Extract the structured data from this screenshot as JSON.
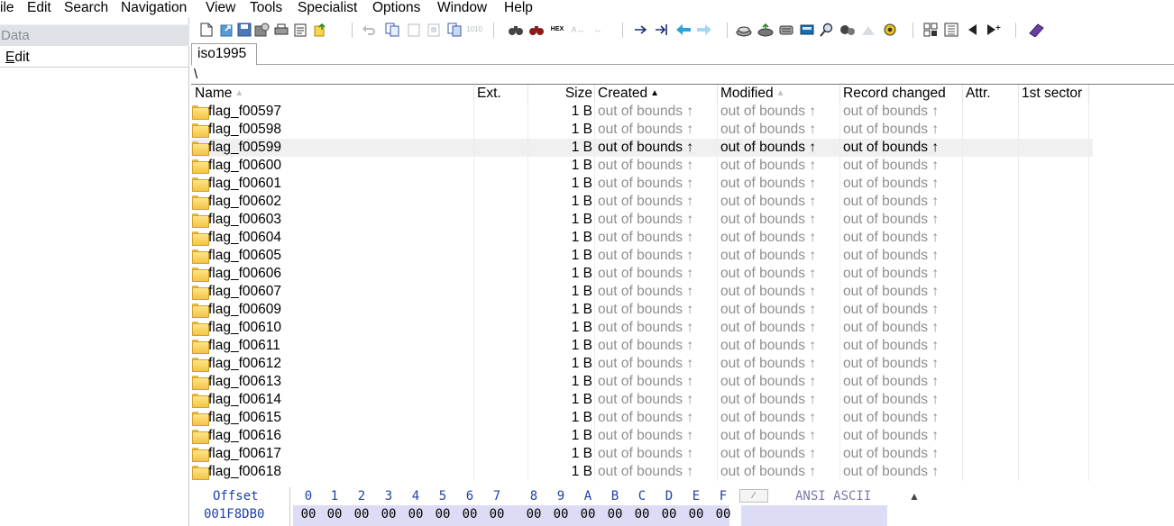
{
  "menu": [
    "ile",
    "Edit",
    "Search",
    "Navigation",
    "View",
    "Tools",
    "Specialist",
    "Options",
    "Window",
    "Help"
  ],
  "left_panel": {
    "header": "Data",
    "edit_prefix": "E",
    "edit_rest": "dit"
  },
  "toolbar": {
    "icons": [
      "new-file-icon",
      "open-file-icon",
      "save-icon",
      "save-as-icon",
      "print-icon",
      "properties-icon",
      "exit-icon",
      "undo-icon",
      "copy-icon",
      "paste-icon",
      "paste-write-icon",
      "copy-hex-icon",
      "find-icon",
      "find-text-icon",
      "find-hex-icon",
      "replace-text-icon",
      "replace-hex-icon",
      "goto-offset-icon",
      "goto-sector-icon",
      "back-icon",
      "forward-icon",
      "open-disk-icon",
      "open-ram-icon",
      "disk-clone-icon",
      "calculator-icon",
      "zoom-icon",
      "tools-icon",
      "hash-icon",
      "gear-icon",
      "directory-browser-icon",
      "sector-view-icon",
      "previous-icon",
      "next-icon",
      "manual-icon"
    ]
  },
  "tab": {
    "label": "iso1995"
  },
  "path": "\\",
  "columns": {
    "name": "Name",
    "ext": "Ext.",
    "size": "Size",
    "created": "Created",
    "modified": "Modified",
    "record_changed": "Record changed",
    "attr": "Attr.",
    "first_sector": "1st sector"
  },
  "sorted_column": "Created",
  "rows": [
    {
      "name": "flag_f00597",
      "size": "1 B",
      "created": "out of bounds ↑",
      "modified": "out of bounds ↑",
      "record_changed": "out of bounds ↑"
    },
    {
      "name": "flag_f00598",
      "size": "1 B",
      "created": "out of bounds ↑",
      "modified": "out of bounds ↑",
      "record_changed": "out of bounds ↑"
    },
    {
      "name": "flag_f00599",
      "size": "1 B",
      "created": "out of bounds ↑",
      "modified": "out of bounds ↑",
      "record_changed": "out of bounds ↑",
      "selected": true
    },
    {
      "name": "flag_f00600",
      "size": "1 B",
      "created": "out of bounds ↑",
      "modified": "out of bounds ↑",
      "record_changed": "out of bounds ↑"
    },
    {
      "name": "flag_f00601",
      "size": "1 B",
      "created": "out of bounds ↑",
      "modified": "out of bounds ↑",
      "record_changed": "out of bounds ↑"
    },
    {
      "name": "flag_f00602",
      "size": "1 B",
      "created": "out of bounds ↑",
      "modified": "out of bounds ↑",
      "record_changed": "out of bounds ↑"
    },
    {
      "name": "flag_f00603",
      "size": "1 B",
      "created": "out of bounds ↑",
      "modified": "out of bounds ↑",
      "record_changed": "out of bounds ↑"
    },
    {
      "name": "flag_f00604",
      "size": "1 B",
      "created": "out of bounds ↑",
      "modified": "out of bounds ↑",
      "record_changed": "out of bounds ↑"
    },
    {
      "name": "flag_f00605",
      "size": "1 B",
      "created": "out of bounds ↑",
      "modified": "out of bounds ↑",
      "record_changed": "out of bounds ↑"
    },
    {
      "name": "flag_f00606",
      "size": "1 B",
      "created": "out of bounds ↑",
      "modified": "out of bounds ↑",
      "record_changed": "out of bounds ↑"
    },
    {
      "name": "flag_f00607",
      "size": "1 B",
      "created": "out of bounds ↑",
      "modified": "out of bounds ↑",
      "record_changed": "out of bounds ↑"
    },
    {
      "name": "flag_f00609",
      "size": "1 B",
      "created": "out of bounds ↑",
      "modified": "out of bounds ↑",
      "record_changed": "out of bounds ↑"
    },
    {
      "name": "flag_f00610",
      "size": "1 B",
      "created": "out of bounds ↑",
      "modified": "out of bounds ↑",
      "record_changed": "out of bounds ↑"
    },
    {
      "name": "flag_f00611",
      "size": "1 B",
      "created": "out of bounds ↑",
      "modified": "out of bounds ↑",
      "record_changed": "out of bounds ↑"
    },
    {
      "name": "flag_f00612",
      "size": "1 B",
      "created": "out of bounds ↑",
      "modified": "out of bounds ↑",
      "record_changed": "out of bounds ↑"
    },
    {
      "name": "flag_f00613",
      "size": "1 B",
      "created": "out of bounds ↑",
      "modified": "out of bounds ↑",
      "record_changed": "out of bounds ↑"
    },
    {
      "name": "flag_f00614",
      "size": "1 B",
      "created": "out of bounds ↑",
      "modified": "out of bounds ↑",
      "record_changed": "out of bounds ↑"
    },
    {
      "name": "flag_f00615",
      "size": "1 B",
      "created": "out of bounds ↑",
      "modified": "out of bounds ↑",
      "record_changed": "out of bounds ↑"
    },
    {
      "name": "flag_f00616",
      "size": "1 B",
      "created": "out of bounds ↑",
      "modified": "out of bounds ↑",
      "record_changed": "out of bounds ↑"
    },
    {
      "name": "flag_f00617",
      "size": "1 B",
      "created": "out of bounds ↑",
      "modified": "out of bounds ↑",
      "record_changed": "out of bounds ↑"
    },
    {
      "name": "flag_f00618",
      "size": "1 B",
      "created": "out of bounds ↑",
      "modified": "out of bounds ↑",
      "record_changed": "out of bounds ↑"
    }
  ],
  "hex": {
    "offset_label": "Offset",
    "offset_value": "001F8DB0",
    "columns": [
      "0",
      "1",
      "2",
      "3",
      "4",
      "5",
      "6",
      "7",
      "8",
      "9",
      "A",
      "B",
      "C",
      "D",
      "E",
      "F"
    ],
    "bytes": [
      "00",
      "00",
      "00",
      "00",
      "00",
      "00",
      "00",
      "00",
      "00",
      "00",
      "00",
      "00",
      "00",
      "00",
      "00",
      "00"
    ],
    "ascii_label": "ANSI ASCII"
  },
  "colors": {
    "dim_text": "#8e8e8e",
    "hex_blue": "#1f3fa8",
    "hex_highlight": "#dcdcf6",
    "folder": "#f3c443"
  }
}
